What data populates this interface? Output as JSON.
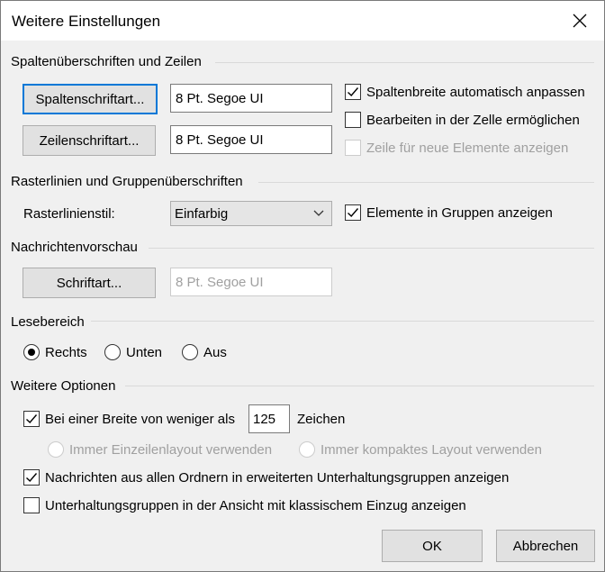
{
  "dialog": {
    "title": "Weitere Einstellungen"
  },
  "columns": {
    "heading": "Spaltenüberschriften und Zeilen",
    "column_font_button": "Spaltenschriftart...",
    "column_font_value": "8 Pt. Segoe UI",
    "row_font_button": "Zeilenschriftart...",
    "row_font_value": "8 Pt. Segoe UI",
    "autofit_label": "Spaltenbreite automatisch anpassen",
    "autofit_checked": true,
    "inplace_edit_label": "Bearbeiten in der Zelle ermöglichen",
    "inplace_edit_checked": false,
    "new_row_label": "Zeile für neue Elemente anzeigen",
    "new_row_checked": false
  },
  "grid": {
    "heading": "Rasterlinien und Gruppenüberschriften",
    "style_label": "Rasterlinienstil:",
    "style_value": "Einfarbig",
    "show_groups_label": "Elemente in Gruppen anzeigen",
    "show_groups_checked": true
  },
  "preview": {
    "heading": "Nachrichtenvorschau",
    "font_button": "Schriftart...",
    "font_value": "8 Pt. Segoe UI"
  },
  "reading_pane": {
    "heading": "Lesebereich",
    "options": [
      "Rechts",
      "Unten",
      "Aus"
    ],
    "selected": "Rechts"
  },
  "more": {
    "heading": "Weitere Optionen",
    "width_prefix": "Bei einer Breite von weniger als",
    "width_value": "125",
    "width_suffix": "Zeichen",
    "width_checked": true,
    "single_line_label": "Immer Einzeilenlayout verwenden",
    "compact_label": "Immer kompaktes Layout verwenden",
    "all_folders_label": "Nachrichten aus allen Ordnern in erweiterten Unterhaltungsgruppen anzeigen",
    "all_folders_checked": true,
    "classic_indent_label": "Unterhaltungsgruppen in der Ansicht mit klassischem Einzug anzeigen",
    "classic_indent_checked": false
  },
  "footer": {
    "ok": "OK",
    "cancel": "Abbrechen"
  }
}
